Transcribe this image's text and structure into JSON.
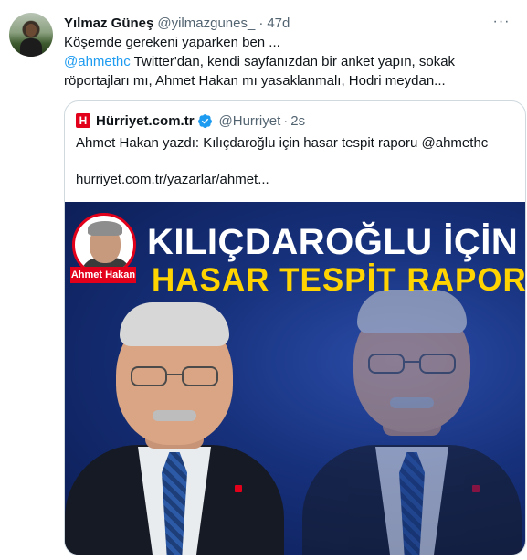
{
  "tweet": {
    "author_name": "Yılmaz Güneş",
    "author_handle": "@yilmazgunes_",
    "separator": "·",
    "time": "47d",
    "more_label": "···",
    "line1": "Köşemde gerekeni yaparken ben ...",
    "line2_mention": "@ahmethc",
    "line2_rest": " Twitter'dan, kendi sayfanızdan bir anket yapın, sokak",
    "line3": "röportajları mı, Ahmet Hakan mı yasaklanmalı, Hodri meydan..."
  },
  "quote": {
    "logo_letter": "H",
    "name": "Hürriyet.com.tr",
    "handle": "@Hurriyet",
    "separator": "·",
    "time": "2s",
    "text": "Ahmet Hakan yazdı: Kılıçdaroğlu için hasar tespit raporu @ahmethc",
    "link": "hurriyet.com.tr/yazarlar/ahmet..."
  },
  "media": {
    "headline_line1": "KILIÇDAROĞLU İÇİN",
    "headline_line2": "HASAR TESPİT RAPORU",
    "author_label": "Ahmet Hakan"
  },
  "colors": {
    "accent": "#1d9bf0",
    "brand_red": "#e2001a",
    "headline_yellow": "#ffd400",
    "media_blue": "#16307a"
  }
}
